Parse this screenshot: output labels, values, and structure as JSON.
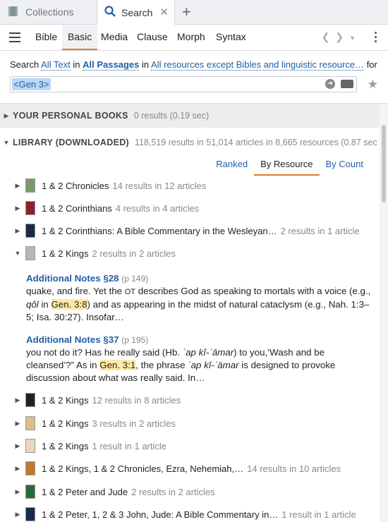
{
  "tabs": [
    {
      "label": "Collections",
      "icon": "collections-icon"
    },
    {
      "label": "Search",
      "icon": "search-icon"
    }
  ],
  "subnav": [
    "Bible",
    "Basic",
    "Media",
    "Clause",
    "Morph",
    "Syntax"
  ],
  "active_subnav": "Basic",
  "query": {
    "prefix": "Search",
    "scope1": "All Text",
    "in1": "in",
    "scope2": "All Passages",
    "in2": "in",
    "scope3": "All resources except Bibles and linguistic resource…",
    "suffix": "for",
    "input_value": "<Gen 3>"
  },
  "groups": {
    "personal": {
      "title": "YOUR PERSONAL BOOKS",
      "meta": "0 results (0.19 sec)"
    },
    "library": {
      "title": "LIBRARY (DOWNLOADED)",
      "meta": "118,519 results in 51,014 articles in 8,665 resources (0.87 sec"
    }
  },
  "sort_tabs": [
    "Ranked",
    "By Resource",
    "By Count"
  ],
  "active_sort": "By Resource",
  "results": [
    {
      "title": "1 & 2 Chronicles",
      "count": "14 results in 12 articles",
      "cover": "#7a9a6a"
    },
    {
      "title": "1 & 2 Corinthians",
      "count": "4 results in 4 articles",
      "cover": "#8a2030"
    },
    {
      "title": "1 & 2 Corinthians: A Bible Commentary in the Wesleyan…",
      "count": "2 results in 1 article",
      "cover": "#1a2a4a"
    },
    {
      "title": "1 & 2 Kings",
      "count": "2 results in 2 articles",
      "cover": "#b8b8b0",
      "expanded": true
    },
    {
      "title": "1 & 2 Kings",
      "count": "12 results in 8 articles",
      "cover": "#222222"
    },
    {
      "title": "1 & 2 Kings",
      "count": "3 results in 2 articles",
      "cover": "#d8c08a"
    },
    {
      "title": "1 & 2 Kings",
      "count": "1 result in 1 article",
      "cover": "#e8d8c0"
    },
    {
      "title": "1 & 2 Kings, 1 & 2 Chronicles, Ezra, Nehemiah,…",
      "count": "14 results in 10 articles",
      "cover": "#c07830"
    },
    {
      "title": "1 & 2 Peter and Jude",
      "count": "2 results in 2 articles",
      "cover": "#2a6a3a"
    },
    {
      "title": "1 & 2 Peter, 1, 2 & 3 John, Jude: A Bible Commentary in…",
      "count": "1 result in 1 article",
      "cover": "#1a2a4a"
    }
  ],
  "snippets": [
    {
      "heading": "Additional Notes §28",
      "page": "(p 149)",
      "t1": "quake, and fire. Yet the ",
      "sc": "ot",
      "t2": " describes God as speaking to mortals with a voice (e.g., ",
      "it1": "qôl",
      "t3": " in ",
      "hl": "Gen. 3:8",
      "t4": ") and as appearing in the midst of natural cataclysm (e.g., Nah. 1:3–5; Isa. 30:27). Insofar…"
    },
    {
      "heading": "Additional Notes §37",
      "page": "(p 195)",
      "t1": "you not do it? Has he really said (Hb. ",
      "it1": "ʾap kî-ʾāmar",
      "t2": ") to you,‘Wash and be cleansed’?” As in ",
      "hl": "Gen. 3:1",
      "t3": ", the phrase ",
      "it2": "ʾap kî-ʾāmar",
      "t4": " is designed to provoke discussion about what was really said. In…"
    }
  ]
}
